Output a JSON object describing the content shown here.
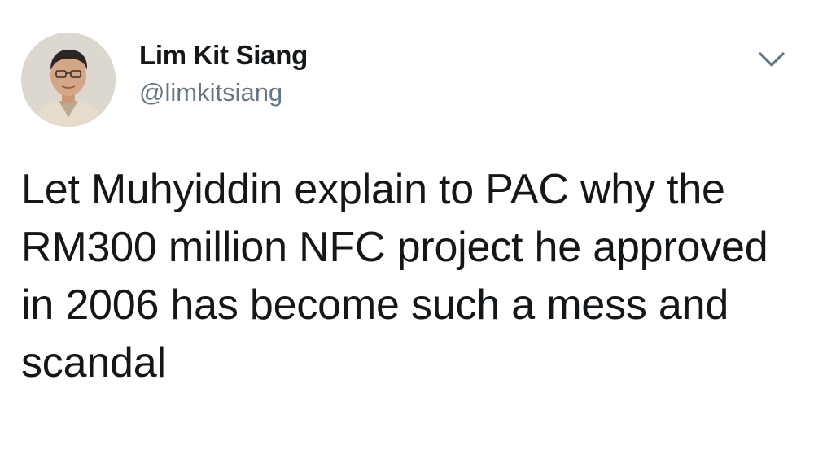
{
  "tweet": {
    "author": {
      "display_name": "Lim Kit Siang",
      "handle": "@limkitsiang",
      "avatar_icon": "profile-photo"
    },
    "menu_icon": "chevron-down-icon",
    "text": "Let Muhyiddin explain to PAC why the RM300 million NFC project he approved in 2006 has become such a mess and scandal"
  },
  "colors": {
    "text_primary": "#14171a",
    "text_secondary": "#657786",
    "background": "#ffffff"
  }
}
